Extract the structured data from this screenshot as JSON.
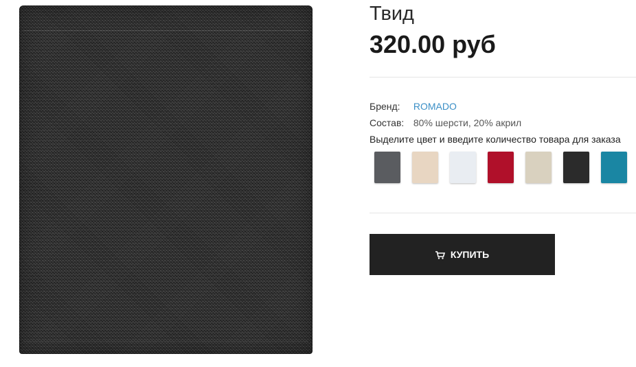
{
  "product": {
    "title": "Твид",
    "price": "320.00 руб",
    "brand_label": "Бренд:",
    "brand_value": "ROMADO",
    "composition_label": "Состав:",
    "composition_value": "80% шерсти, 20% акрил",
    "hint": "Выделите цвет и введите количество товара для заказа"
  },
  "swatches": [
    {
      "name": "grey",
      "color": "#5a5c60"
    },
    {
      "name": "beige",
      "color": "#e8d6c2"
    },
    {
      "name": "white",
      "color": "#e9edf2"
    },
    {
      "name": "red",
      "color": "#b0102a"
    },
    {
      "name": "sand",
      "color": "#d9d1bf"
    },
    {
      "name": "black",
      "color": "#2b2b2b"
    },
    {
      "name": "teal",
      "color": "#1a86a3"
    }
  ],
  "buy": {
    "label": "КУПИТЬ",
    "icon": "cart-icon"
  },
  "colors": {
    "accent_link": "#3b8fc6",
    "button_bg": "#222222",
    "fabric": "#2c2c2c"
  }
}
